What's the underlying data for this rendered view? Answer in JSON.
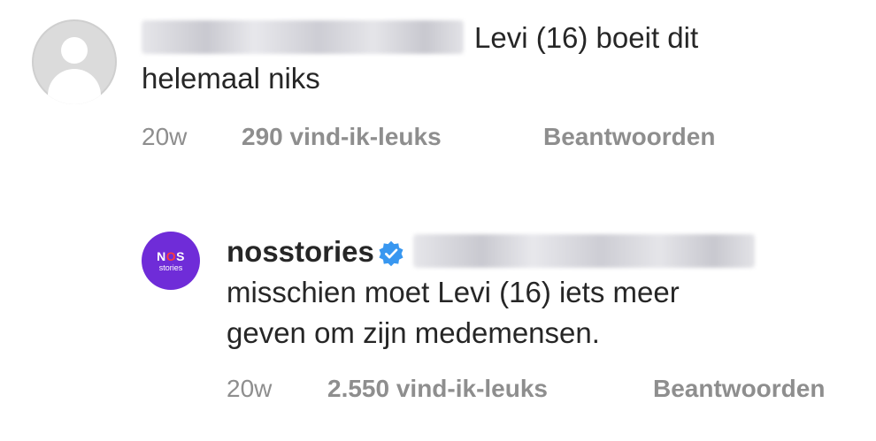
{
  "comments": [
    {
      "username_blurred": true,
      "text_line1": "Levi (16) boeit dit",
      "text_line2": "helemaal niks",
      "time": "20w",
      "likes": "290 vind-ik-leuks",
      "reply_label": "Beantwoorden"
    },
    {
      "username": "nosstories",
      "verified": true,
      "mention_blurred": true,
      "text_line1": "misschien moet Levi (16) iets meer",
      "text_line2": "geven om zijn medemensen.",
      "time": "20w",
      "likes": "2.550 vind-ik-leuks",
      "reply_label": "Beantwoorden",
      "avatar": {
        "logo_n": "N",
        "logo_o": "O",
        "logo_s": "S",
        "logo_sub": "stories"
      }
    }
  ],
  "colors": {
    "text": "#262626",
    "meta": "#8e8e8e",
    "verified": "#3897f0",
    "nos_purple": "#6f2cd8"
  },
  "icons": {
    "default_avatar": "default-avatar-icon",
    "verified_badge": "verified-badge-icon"
  }
}
